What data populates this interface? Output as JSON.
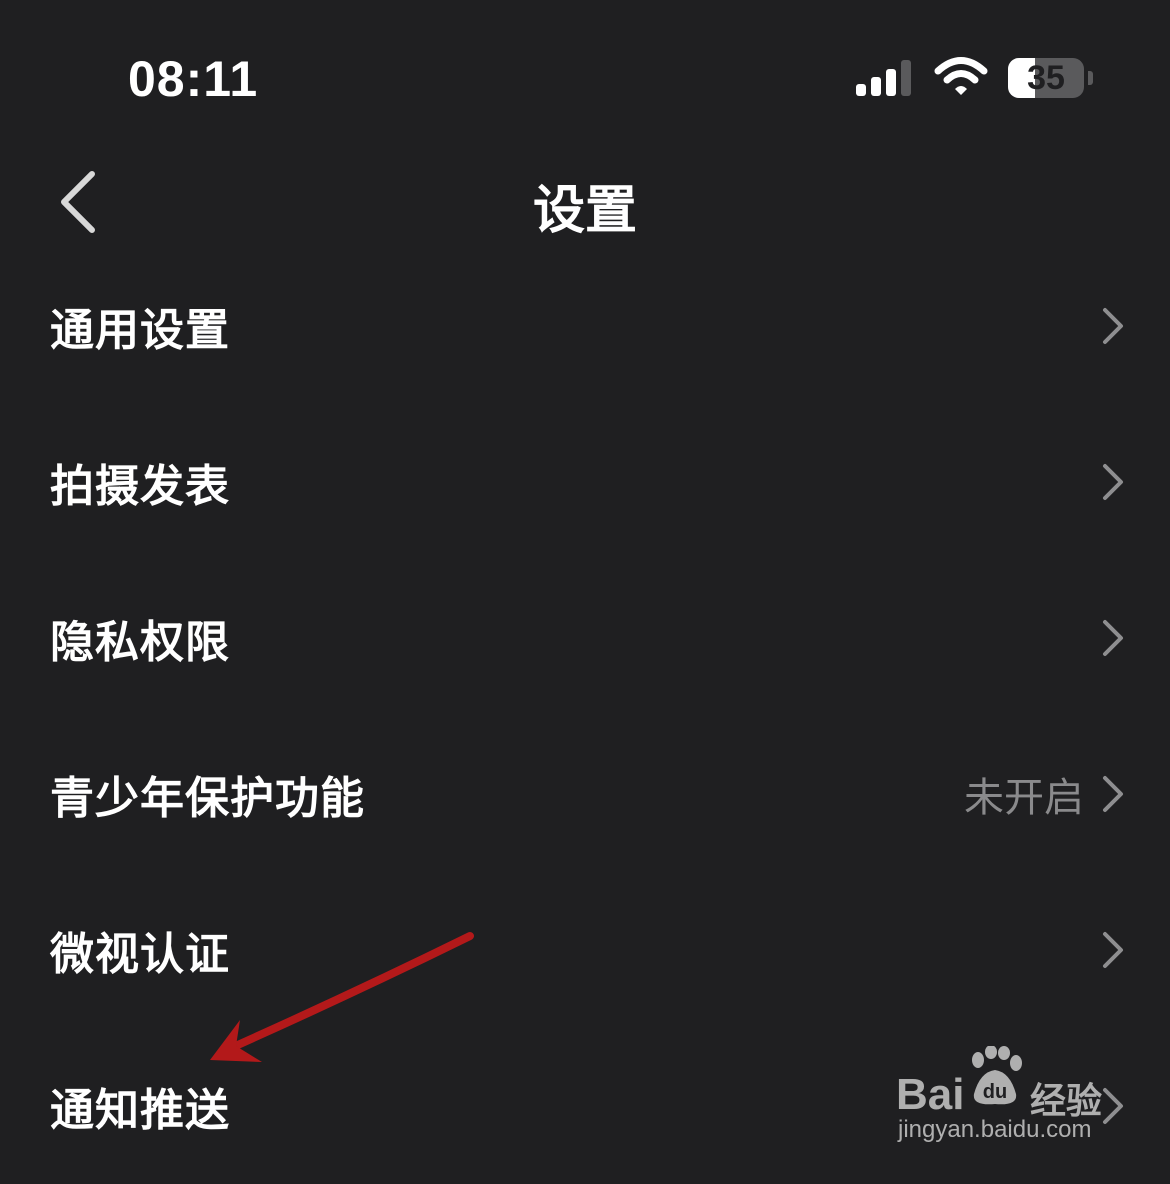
{
  "status_bar": {
    "time": "08:11",
    "battery_level": 35,
    "battery_text": "35",
    "signal_icon": "cellular-signal-icon",
    "wifi_icon": "wifi-icon"
  },
  "nav": {
    "title": "设置",
    "back_icon": "chevron-left-icon"
  },
  "settings": {
    "items": [
      {
        "label": "通用设置",
        "value": ""
      },
      {
        "label": "拍摄发表",
        "value": ""
      },
      {
        "label": "隐私权限",
        "value": ""
      },
      {
        "label": "青少年保护功能",
        "value": "未开启"
      },
      {
        "label": "微视认证",
        "value": ""
      },
      {
        "label": "通知推送",
        "value": ""
      }
    ]
  },
  "annotation": {
    "arrow_color": "#b3191a"
  },
  "watermark": {
    "brand": "Bai",
    "brand_cn": "经验",
    "url": "jingyan.baidu.com"
  },
  "colors": {
    "background": "#1f1f21",
    "text": "#ffffff",
    "secondary_text": "#8a8a8c",
    "chevron": "#8e8e90"
  }
}
